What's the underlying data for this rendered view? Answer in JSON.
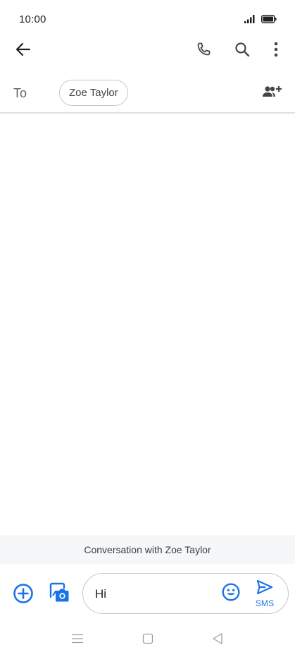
{
  "status_bar": {
    "time": "10:00",
    "icons": [
      "signal-icon",
      "battery-icon"
    ]
  },
  "app_bar": {
    "icons": [
      "back-arrow-icon",
      "phone-icon",
      "search-icon",
      "more-vert-icon"
    ]
  },
  "recipients": {
    "to_label": "To",
    "chips": [
      "Zoe Taylor"
    ],
    "add_icon": "add-people-icon"
  },
  "conversation": {
    "banner": "Conversation with Zoe Taylor"
  },
  "compose": {
    "text": "Hi",
    "send_label": "SMS",
    "icons": [
      "add-circle-icon",
      "gallery-camera-icon",
      "emoji-icon",
      "send-icon"
    ]
  },
  "nav_bar": {
    "icons": [
      "menu-icon",
      "home-icon",
      "back-triangle-icon"
    ]
  },
  "colors": {
    "accent": "#1a73e8",
    "icon_dark": "#444746",
    "banner_bg": "#f6f7f9"
  }
}
